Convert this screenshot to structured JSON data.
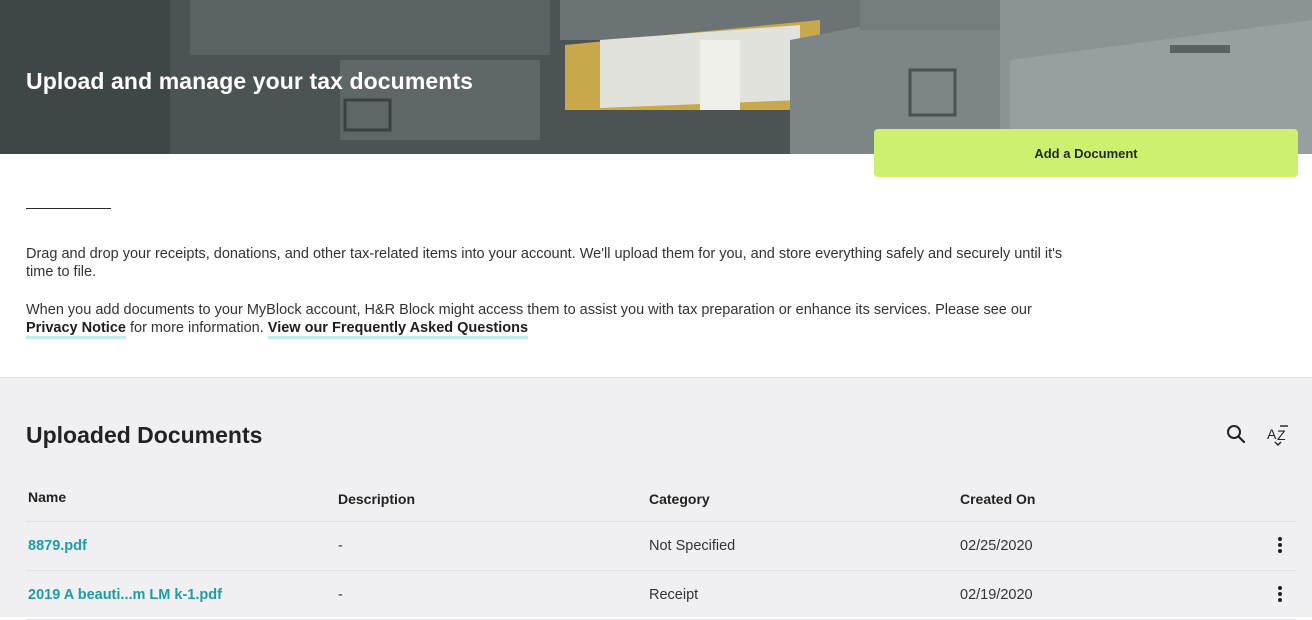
{
  "hero": {
    "title": "Upload and manage your tax documents",
    "background_color": "#4f5759"
  },
  "actions": {
    "add_document_label": "Add a Document",
    "accent_color": "#cdf06f"
  },
  "intro": {
    "paragraph1": "Drag and drop your receipts, donations, and other tax-related items into your account. We'll upload them for you, and store everything safely and securely until it's time to file.",
    "paragraph2_text": "When you add documents to your MyBlock account, H&R Block might access them to assist you with tax preparation or enhance its services. Please see our ",
    "privacy_link": "Privacy Notice",
    "paragraph2_mid": " for more information. ",
    "faq_link": "View our Frequently Asked Questions"
  },
  "documents": {
    "title": "Uploaded Documents",
    "search_icon": "search-icon",
    "sort_icon": "sort-az-icon",
    "columns": [
      "Name",
      "Description",
      "Category",
      "Created On"
    ],
    "rows": [
      {
        "name": "8879.pdf",
        "description": "-",
        "category": "Not Specified",
        "created": "02/25/2020"
      },
      {
        "name": "2019 A beauti...m LM k-1.pdf",
        "description": "-",
        "category": "Receipt",
        "created": "02/19/2020"
      }
    ],
    "link_color": "#1b9ea8"
  }
}
